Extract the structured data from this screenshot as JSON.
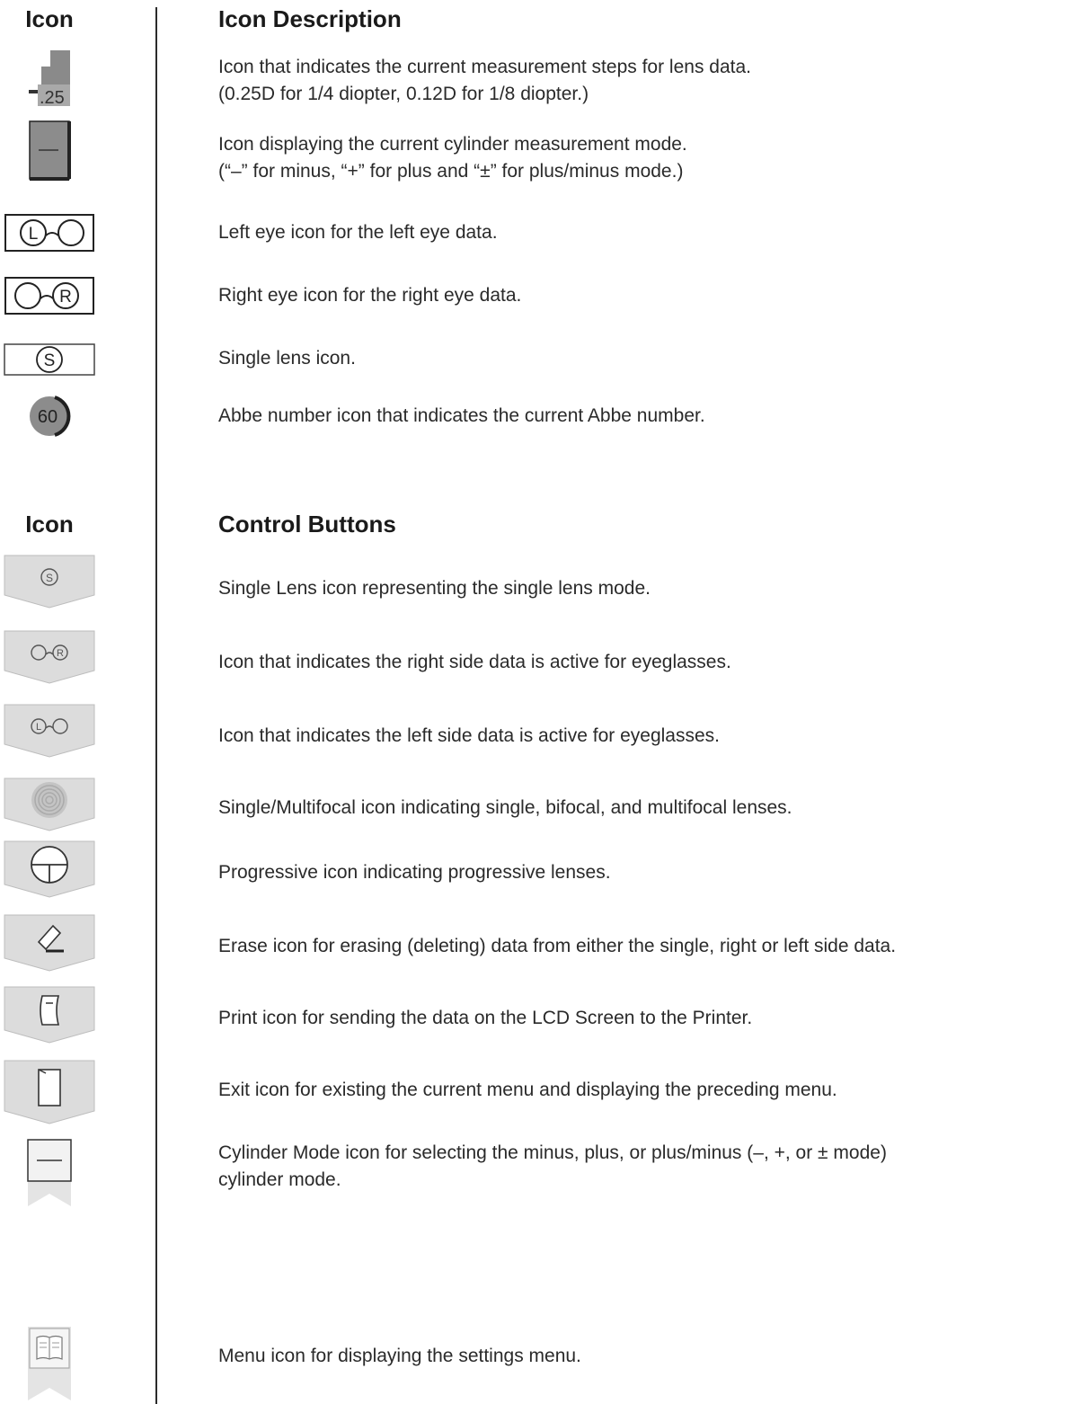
{
  "headers": {
    "icon_col_1": "Icon",
    "desc_col_1": "Icon Description",
    "icon_col_2": "Icon",
    "desc_col_2": "Control Buttons"
  },
  "status_icons": [
    {
      "icon": "step-025-icon",
      "glyph": "-.25",
      "text": "Icon that indicates the current measurement steps for lens data.\n(0.25D for 1/4 diopter, 0.12D for 1/8 diopter.)"
    },
    {
      "icon": "cylinder-minus-icon",
      "glyph": "—",
      "text": "Icon displaying the current cylinder measurement mode.\n(“–” for minus, “+” for plus and “±” for plus/minus mode.)"
    },
    {
      "icon": "left-eye-icon",
      "glyph": "L",
      "text": "Left eye icon for the left eye data."
    },
    {
      "icon": "right-eye-icon",
      "glyph": "R",
      "text": "Right eye icon for the right eye data."
    },
    {
      "icon": "single-lens-icon",
      "glyph": "S",
      "text": "Single lens icon."
    },
    {
      "icon": "abbe-number-icon",
      "glyph": "60",
      "text": "Abbe number icon that indicates the current Abbe number."
    }
  ],
  "control_buttons": [
    {
      "icon": "single-lens-button-icon",
      "glyph": "S",
      "text": "Single Lens icon representing the single lens mode."
    },
    {
      "icon": "right-side-button-icon",
      "glyph": "R",
      "text": "Icon that indicates the right side data is active for eyeglasses."
    },
    {
      "icon": "left-side-button-icon",
      "glyph": "L",
      "text": "Icon that indicates the left side data is active for eyeglasses."
    },
    {
      "icon": "multifocal-button-icon",
      "text": "Single/Multifocal icon indicating single, bifocal, and multifocal lenses."
    },
    {
      "icon": "progressive-button-icon",
      "text": "Progressive icon indicating progressive lenses."
    },
    {
      "icon": "erase-button-icon",
      "text": "Erase icon for erasing (deleting) data from either the single, right or left side data."
    },
    {
      "icon": "print-button-icon",
      "text": "Print icon for sending the data on the LCD Screen to the Printer."
    },
    {
      "icon": "exit-button-icon",
      "text": "Exit icon for existing the current menu and displaying the preceding menu."
    },
    {
      "icon": "cylinder-mode-button-icon",
      "glyph": "—",
      "text": "Cylinder Mode icon for selecting the minus, plus, or plus/minus (–, +, or ± mode)\ncylinder mode."
    },
    {
      "icon": "menu-button-icon",
      "text": "Menu icon for displaying the settings menu."
    }
  ]
}
